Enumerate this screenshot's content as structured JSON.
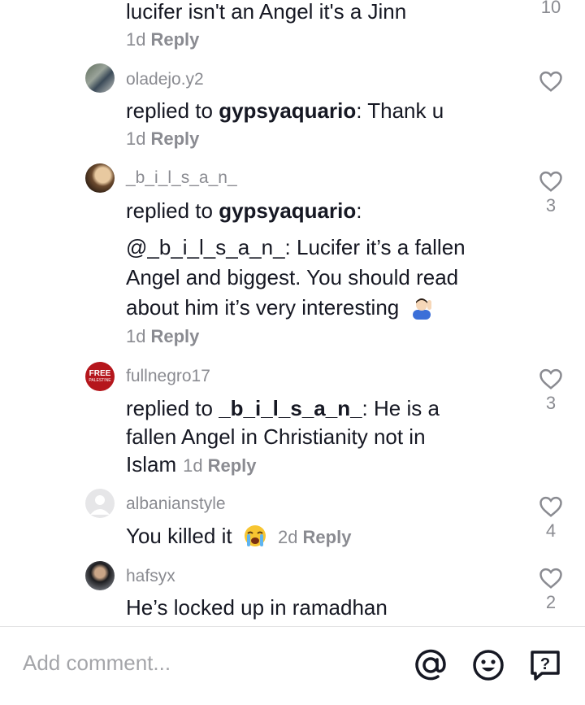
{
  "comments": [
    {
      "text": "lucifer isn't an Angel it's a Jinn",
      "time": "1d",
      "reply": "Reply",
      "likes": "10"
    },
    {
      "user": "oladejo.y2",
      "prefix": "replied to ",
      "mention": "gypsyaquario",
      "text": ": Thank u",
      "time": "1d",
      "reply": "Reply",
      "likes": ""
    },
    {
      "user": "_b_i_l_s_a_n_",
      "prefix": "replied to ",
      "mention": "gypsyaquario",
      "text": ":",
      "body_line1": "@_b_i_l_s_a_n_:  Lucifer it’s a fallen",
      "body_line2": "Angel and biggest. You should read",
      "body_line3": "about him it’s very interesting",
      "time": "1d",
      "reply": "Reply",
      "likes": "3"
    },
    {
      "user": "fullnegro17",
      "avatar_text": "FREE",
      "avatar_sub": "PALESTINE",
      "prefix": "replied to ",
      "mention": "_b_i_l_s_a_n_",
      "text_line1": ": He is a",
      "text_line2": "fallen Angel in Christianity not in",
      "text_line3": "Islam",
      "time": "1d",
      "reply": "Reply",
      "likes": "3"
    },
    {
      "user": "albanianstyle",
      "text": "You killed it",
      "time": "2d",
      "reply": "Reply",
      "likes": "4"
    },
    {
      "user": "hafsyx",
      "text": "He’s locked up in ramadhan",
      "likes": "2"
    }
  ],
  "composer": {
    "placeholder": "Add comment..."
  },
  "icons": {
    "like": "heart-outline-icon",
    "mention": "at-sign-icon",
    "emoji": "smiley-icon",
    "question": "question-box-icon"
  }
}
